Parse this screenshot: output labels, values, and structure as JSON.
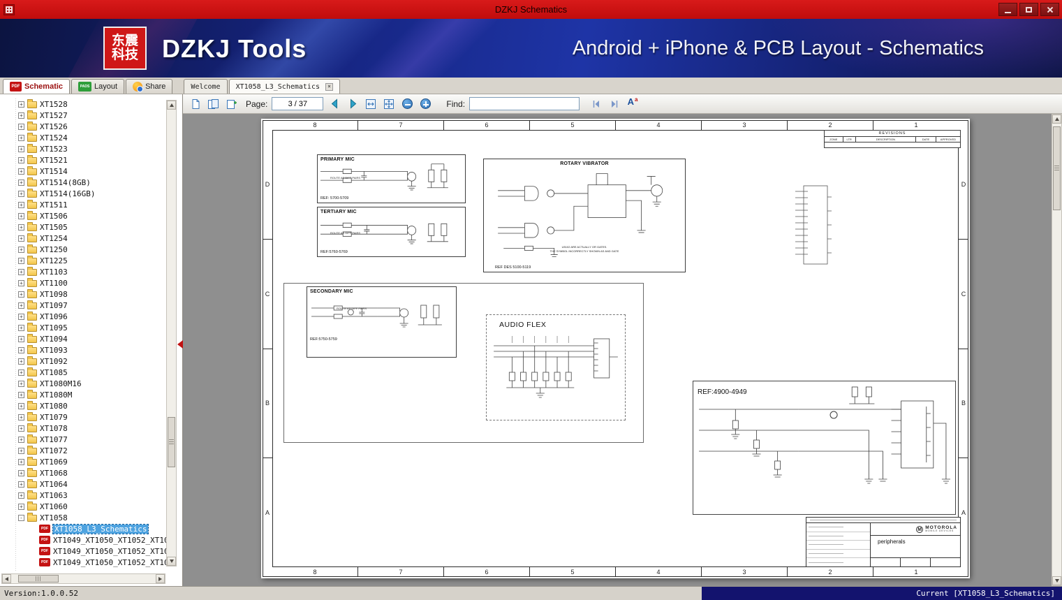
{
  "window": {
    "title": "DZKJ Schematics"
  },
  "banner": {
    "logo_line1": "东震",
    "logo_line2": "科技",
    "app_name": "DZKJ Tools",
    "tagline": "Android + iPhone & PCB Layout - Schematics"
  },
  "icons": {
    "pdf": "PDF",
    "pads": "PADS",
    "expand": "+",
    "collapse": "-",
    "close_tab": "×",
    "match_case_big": "A",
    "match_case_small": "a"
  },
  "tabs": {
    "tools": [
      {
        "label": "Schematic"
      },
      {
        "label": "Layout"
      },
      {
        "label": "Share"
      }
    ],
    "documents": [
      {
        "label": "Welcome"
      },
      {
        "label": "XT1058_L3_Schematics"
      }
    ]
  },
  "toolbar": {
    "page_label": "Page:",
    "page_value": "3 / 37",
    "find_label": "Find:",
    "find_value": ""
  },
  "sidebar": {
    "folders": [
      "XT1528",
      "XT1527",
      "XT1526",
      "XT1524",
      "XT1523",
      "XT1521",
      "XT1514",
      "XT1514(8GB)",
      "XT1514(16GB)",
      "XT1511",
      "XT1506",
      "XT1505",
      "XT1254",
      "XT1250",
      "XT1225",
      "XT1103",
      "XT1100",
      "XT1098",
      "XT1097",
      "XT1096",
      "XT1095",
      "XT1094",
      "XT1093",
      "XT1092",
      "XT1085",
      "XT1080M16",
      "XT1080M",
      "XT1080",
      "XT1079",
      "XT1078",
      "XT1077",
      "XT1072",
      "XT1069",
      "XT1068",
      "XT1064",
      "XT1063",
      "XT1060"
    ],
    "expanded_folder": "XT1058",
    "documents": [
      {
        "label": "XT1058_L3_Schematics",
        "selected": true
      },
      {
        "label": "XT1049_XT1050_XT1052_XT10",
        "selected": false
      },
      {
        "label": "XT1049_XT1050_XT1052_XT10",
        "selected": false
      },
      {
        "label": "XT1049_XT1050_XT1052_XT10",
        "selected": false
      }
    ]
  },
  "schematic": {
    "columns": [
      "8",
      "7",
      "6",
      "5",
      "4",
      "3",
      "2",
      "1"
    ],
    "rows": [
      "D",
      "C",
      "B",
      "A"
    ],
    "revisions": {
      "title": "REVISIONS",
      "headers": [
        "ZONE",
        "LTR",
        "DESCRIPTION",
        "DATE",
        "APPROVED"
      ]
    },
    "blocks": {
      "primary_mic": {
        "title": "PRIMARY MIC",
        "note": "ROUTE AS DIFF PAIRS",
        "ref": "REF: 5700-5709"
      },
      "tertiary_mic": {
        "title": "TERTIARY MIC",
        "note": "ROUTE AS DIFF PAIRS",
        "ref": "REF:5760-5769"
      },
      "rotary_vibrator": {
        "title": "ROTARY VIBRATOR",
        "note1": "U5102 ARE ACTUALLY OR GATES.",
        "note2": "THE SYMBOL INCORRECTLY SHOWN AS AND GATE",
        "ref": "REF DES 5100-5119"
      },
      "secondary_mic": {
        "title": "SECONDARY MIC",
        "note": "ROUTE AS DIFF PAIRS",
        "ref": "REF:5750-5759"
      },
      "audio_flex": {
        "title": "AUDIO FLEX"
      },
      "headset_jack": {
        "ref": "REF:4900-4949"
      }
    },
    "title_block": {
      "logo_letter": "M",
      "company": "MOTOROLA",
      "division": "MOBILE DEVICES",
      "block_title": "peripherals"
    }
  },
  "statusbar": {
    "version": "Version:1.0.0.52",
    "current": "Current [XT1058_L3_Schematics]"
  }
}
